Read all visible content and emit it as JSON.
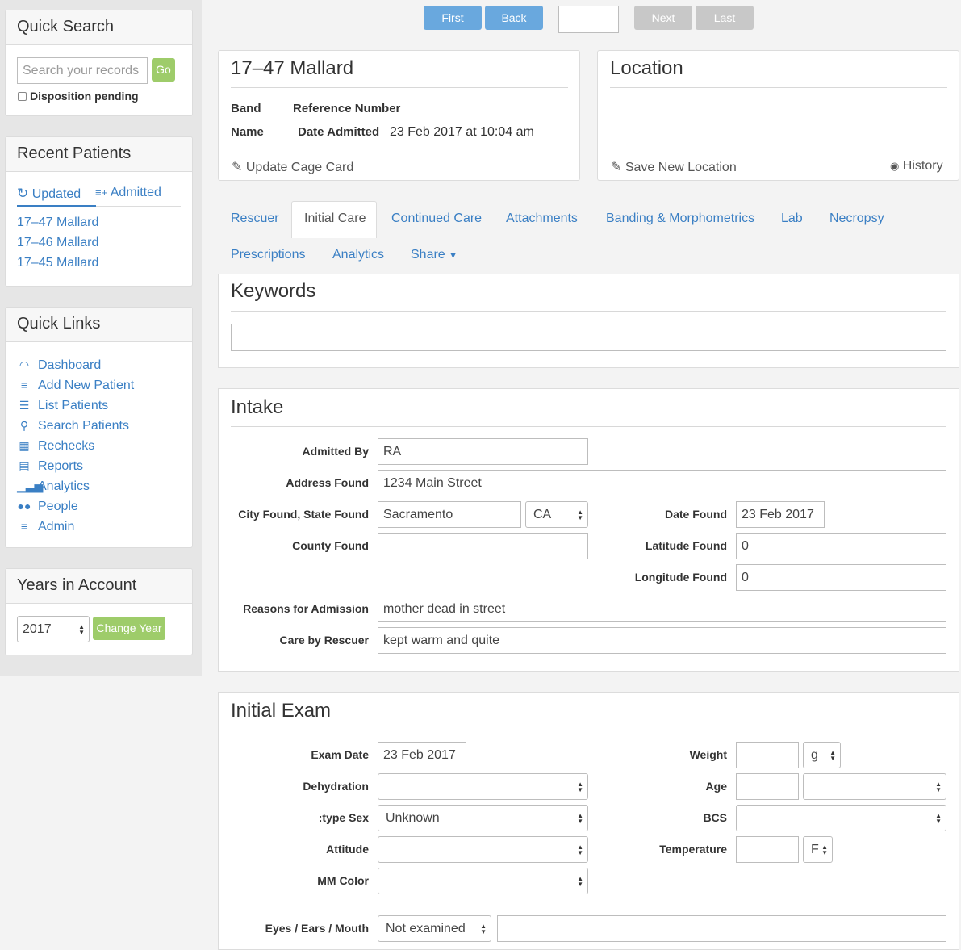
{
  "quick_search": {
    "title": "Quick Search",
    "placeholder": "Search your records",
    "go": "Go",
    "disposition": "Disposition pending"
  },
  "recent": {
    "title": "Recent Patients",
    "tab_updated": "Updated",
    "tab_admitted": "Admitted",
    "patients": [
      "17–47 Mallard",
      "17–46 Mallard",
      "17–45 Mallard"
    ]
  },
  "quick_links": {
    "title": "Quick Links",
    "items": [
      {
        "label": "Dashboard",
        "icon": "gauge-icon"
      },
      {
        "label": "Add New Patient",
        "icon": "add-list-icon"
      },
      {
        "label": "List Patients",
        "icon": "list-icon"
      },
      {
        "label": "Search Patients",
        "icon": "search-icon"
      },
      {
        "label": "Rechecks",
        "icon": "calendar-icon"
      },
      {
        "label": "Reports",
        "icon": "report-icon"
      },
      {
        "label": "Analytics",
        "icon": "bar-chart-icon"
      },
      {
        "label": "People",
        "icon": "people-icon"
      },
      {
        "label": "Admin",
        "icon": "database-icon"
      }
    ]
  },
  "years": {
    "title": "Years in Account",
    "year": "2017",
    "change": "Change Year"
  },
  "pager": {
    "first": "First",
    "back": "Back",
    "page": "",
    "next": "Next",
    "last": "Last"
  },
  "patient": {
    "title": "17–47 Mallard",
    "band_label": "Band",
    "ref_label": "Reference Number",
    "name_label": "Name",
    "date_label": "Date Admitted",
    "date_value": "23 Feb 2017 at 10:04 am",
    "update": "Update Cage Card"
  },
  "location": {
    "title": "Location",
    "save": "Save New Location",
    "history": "History"
  },
  "tabs": [
    "Rescuer",
    "Initial Care",
    "Continued Care",
    "Attachments",
    "Banding & Morphometrics",
    "Lab",
    "Necropsy",
    "Prescriptions",
    "Analytics",
    "Share"
  ],
  "keywords": {
    "title": "Keywords",
    "value": ""
  },
  "intake": {
    "title": "Intake",
    "admitted_by_label": "Admitted By",
    "admitted_by": "RA",
    "address_label": "Address Found",
    "address": "1234 Main Street",
    "city_label": "City Found, State Found",
    "city": "Sacramento",
    "state": "CA",
    "date_label": "Date Found",
    "date": "23 Feb 2017",
    "county_label": "County Found",
    "county": "",
    "lat_label": "Latitude Found",
    "lat": "0",
    "lon_label": "Longitude Found",
    "lon": "0",
    "reasons_label": "Reasons for Admission",
    "reasons": "mother dead in street",
    "care_label": "Care by Rescuer",
    "care": "kept warm and quite"
  },
  "exam": {
    "title": "Initial Exam",
    "date_label": "Exam Date",
    "date": "23 Feb 2017",
    "weight_label": "Weight",
    "weight": "",
    "weight_unit": "g",
    "dehydration_label": "Dehydration",
    "dehydration": "",
    "age_label": "Age",
    "age": "",
    "age_unit": "",
    "sex_label": ":type Sex",
    "sex": "Unknown",
    "bcs_label": "BCS",
    "bcs": "",
    "attitude_label": "Attitude",
    "attitude": "",
    "temp_label": "Temperature",
    "temp": "",
    "temp_unit": "F",
    "mm_label": "MM Color",
    "mm": "",
    "eyes_label": "Eyes / Ears / Mouth",
    "eyes": "Not examined",
    "eyes_note": ""
  },
  "colors": {
    "link": "#3a7fc4",
    "go_button": "#9ecc6a",
    "nav_active": "#69a8de",
    "nav_disabled": "#c8c8c8"
  }
}
